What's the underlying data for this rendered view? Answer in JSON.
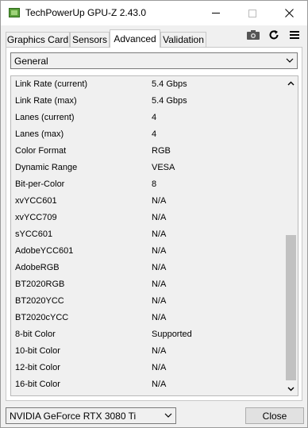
{
  "window": {
    "title": "TechPowerUp GPU-Z 2.43.0"
  },
  "tabs": [
    {
      "label": "Graphics Card"
    },
    {
      "label": "Sensors"
    },
    {
      "label": "Advanced"
    },
    {
      "label": "Validation"
    }
  ],
  "section_select": {
    "value": "General"
  },
  "rows": [
    {
      "key": "Link Rate (current)",
      "value": "5.4 Gbps"
    },
    {
      "key": "Link Rate (max)",
      "value": "5.4 Gbps"
    },
    {
      "key": "Lanes (current)",
      "value": "4"
    },
    {
      "key": "Lanes (max)",
      "value": "4"
    },
    {
      "key": "Color Format",
      "value": "RGB"
    },
    {
      "key": "Dynamic Range",
      "value": "VESA"
    },
    {
      "key": "Bit-per-Color",
      "value": "8"
    },
    {
      "key": "xvYCC601",
      "value": "N/A"
    },
    {
      "key": "xvYCC709",
      "value": "N/A"
    },
    {
      "key": "sYCC601",
      "value": "N/A"
    },
    {
      "key": "AdobeYCC601",
      "value": "N/A"
    },
    {
      "key": "AdobeRGB",
      "value": "N/A"
    },
    {
      "key": "BT2020RGB",
      "value": "N/A"
    },
    {
      "key": "BT2020YCC",
      "value": "N/A"
    },
    {
      "key": "BT2020cYCC",
      "value": "N/A"
    },
    {
      "key": "8-bit Color",
      "value": "Supported"
    },
    {
      "key": "10-bit Color",
      "value": "N/A"
    },
    {
      "key": "12-bit Color",
      "value": "N/A"
    },
    {
      "key": "16-bit Color",
      "value": "N/A"
    }
  ],
  "gpu_select": {
    "value": "NVIDIA GeForce RTX 3080 Ti"
  },
  "buttons": {
    "close": "Close"
  },
  "icons": {
    "app": "gpu-z-app-icon",
    "camera": "camera-icon",
    "refresh": "refresh-icon",
    "menu": "hamburger-menu-icon"
  }
}
